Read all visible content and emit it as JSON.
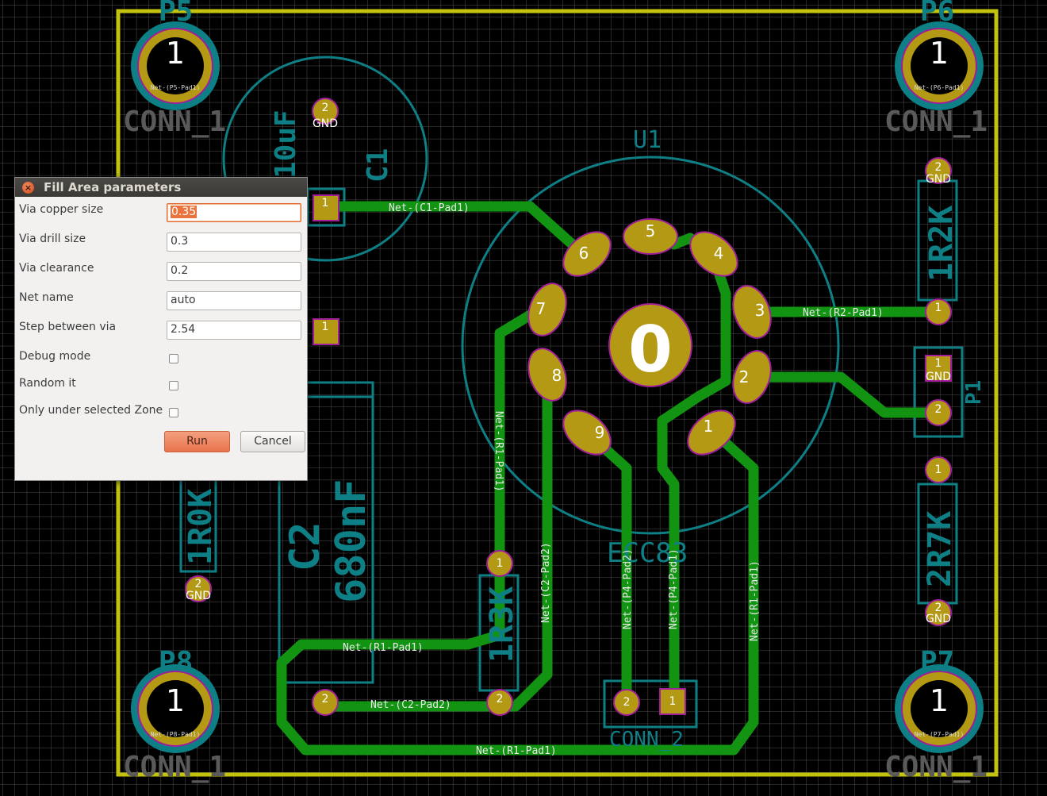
{
  "dialog": {
    "title": "Fill Area parameters",
    "fields": [
      {
        "label": "Via copper size",
        "value": "0.35"
      },
      {
        "label": "Via drill size",
        "value": "0.3"
      },
      {
        "label": "Via clearance",
        "value": "0.2"
      },
      {
        "label": "Net name",
        "value": "auto"
      },
      {
        "label": "Step between via",
        "value": "2.54"
      }
    ],
    "checkboxes": [
      {
        "label": "Debug mode",
        "checked": false
      },
      {
        "label": "Random it",
        "checked": false
      },
      {
        "label": "Only under selected Zone",
        "checked": false
      }
    ],
    "run_label": "Run",
    "cancel_label": "Cancel"
  },
  "pcb": {
    "colors": {
      "background": "#000000",
      "grid": "#5a5a5a",
      "edge": "#c2c20f",
      "copper": "#129412",
      "pad": "#b49a14",
      "silk": "#0f7f86",
      "outline": "#a01e9a",
      "labels": "#ffffff"
    },
    "references": {
      "p5": "P5",
      "p6": "P6",
      "p7": "P7",
      "p8": "P8",
      "u1": "U1",
      "u1_value": "ECC83",
      "c1": "C1",
      "c1_value": "10uF",
      "c2": "C2",
      "c2_value": "680nF",
      "r1": "1R3K",
      "r2": "1R2K",
      "r3": "1R0K",
      "r4": "2R7K",
      "p1_ref": "P1",
      "conn1": "CONN_1",
      "conn2": "CONN_2"
    },
    "pins": {
      "one": "1",
      "two": "2",
      "three": "3",
      "four": "4",
      "five": "5",
      "six": "6",
      "seven": "7",
      "eight": "8",
      "nine": "9",
      "zero": "0",
      "gnd": "GND"
    },
    "nets": {
      "c1_pad1": "Net-(C1-Pad1)",
      "r2_pad1": "Net-(R2-Pad1)",
      "r1_pad1": "Net-(R1-Pad1)",
      "c2_pad2": "Net-(C2-Pad2)",
      "p4_pad2": "Net-(P4-Pad2)",
      "p4_pad1": "Net-(P4-Pad1)",
      "p5_pad1": "Net-(P5-Pad1)",
      "p6_pad1": "Net-(P6-Pad1)",
      "p7_pad1": "Net-(P7-Pad1)",
      "p8_pad1": "Net-(P8-Pad1)"
    }
  }
}
